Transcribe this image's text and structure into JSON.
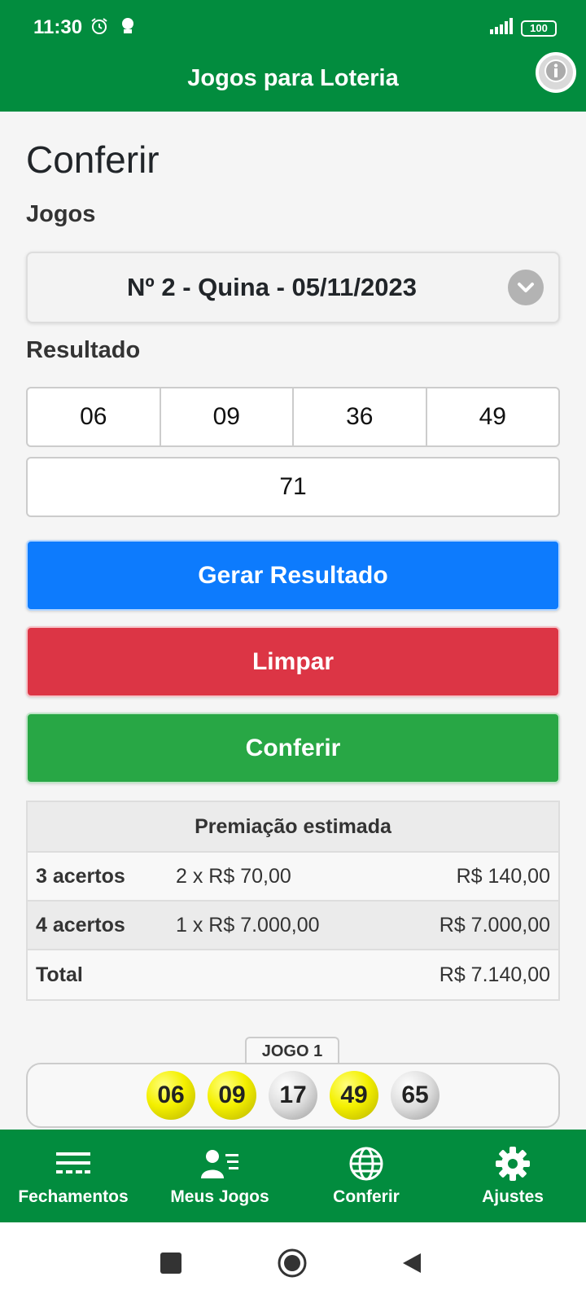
{
  "status_bar": {
    "time": "11:30",
    "battery": "100"
  },
  "app_bar": {
    "title": "Jogos para Loteria"
  },
  "page": {
    "title": "Conferir"
  },
  "jogos": {
    "label": "Jogos",
    "selected": "Nº 2 - Quina - 05/11/2023"
  },
  "resultado": {
    "label": "Resultado",
    "numbers": [
      "06",
      "09",
      "36",
      "49"
    ],
    "last_number": "71"
  },
  "buttons": {
    "gerar": "Gerar Resultado",
    "limpar": "Limpar",
    "conferir": "Conferir"
  },
  "prize": {
    "header": "Premiação estimada",
    "rows": [
      {
        "hits": "3 acertos",
        "calc": "2 x R$ 70,00",
        "value": "R$ 140,00"
      },
      {
        "hits": "4 acertos",
        "calc": "1 x R$ 7.000,00",
        "value": "R$ 7.000,00"
      }
    ],
    "total_label": "Total",
    "total_value": "R$ 7.140,00"
  },
  "game": {
    "label": "JOGO 1",
    "balls": [
      {
        "number": "06",
        "hit": true
      },
      {
        "number": "09",
        "hit": true
      },
      {
        "number": "17",
        "hit": false
      },
      {
        "number": "49",
        "hit": true
      },
      {
        "number": "65",
        "hit": false
      }
    ]
  },
  "bottom_nav": {
    "fechamentos": "Fechamentos",
    "meus_jogos": "Meus Jogos",
    "conferir": "Conferir",
    "ajustes": "Ajustes"
  },
  "colors": {
    "brand_green": "#028c3e",
    "blue": "#0d7bfd",
    "red": "#dc3545",
    "green": "#28a745",
    "hit_yellow": "#f4f000"
  }
}
